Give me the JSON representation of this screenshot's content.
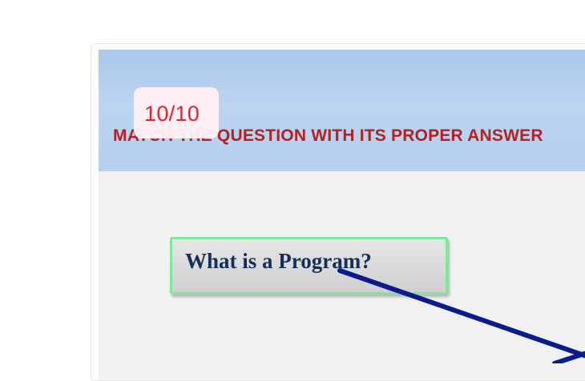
{
  "quiz": {
    "instruction": "MATCH THE QUESTION WITH ITS PROPER ANSWER",
    "score": "10/10",
    "question": "What is a Program?"
  },
  "colors": {
    "header_band": "#b4cff0",
    "instruction_text": "#b22222",
    "score_text": "#e8202a",
    "question_border": "#7ee89a",
    "question_text": "#14305a",
    "connector_line": "#0b1a8c"
  }
}
